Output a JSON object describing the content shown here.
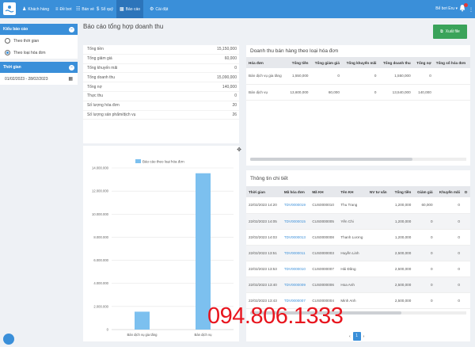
{
  "nav": {
    "items": [
      {
        "label": "Khách hàng",
        "icon": "person-icon"
      },
      {
        "label": "Đề bơi",
        "icon": "pool-icon"
      },
      {
        "label": "Bán vé",
        "icon": "cart-icon"
      },
      {
        "label": "Sổ quỹ",
        "icon": "money-icon"
      },
      {
        "label": "Báo cáo",
        "icon": "chart-icon"
      },
      {
        "label": "Cài đặt",
        "icon": "gear-icon"
      }
    ],
    "user": "Bể bơi Eru",
    "notification_count": "1"
  },
  "sidebar": {
    "report_type": {
      "title": "Kiểu báo cáo",
      "options": [
        "Theo thời gian",
        "Theo loại hóa đơn"
      ],
      "selected": "Theo loại hóa đơn"
    },
    "time": {
      "title": "Thời gian",
      "range": "01/02/2023 - 28/02/2023"
    }
  },
  "page": {
    "title": "Báo cáo tổng hợp doanh thu",
    "export_label": "Xuất file"
  },
  "summary": [
    {
      "label": "Tổng tiền",
      "value": "15,150,000"
    },
    {
      "label": "Tổng giảm giá",
      "value": "60,000"
    },
    {
      "label": "Tổng khuyến mãi",
      "value": "0"
    },
    {
      "label": "Tổng doanh thu",
      "value": "15,090,000"
    },
    {
      "label": "Tổng nợ",
      "value": "140,000"
    },
    {
      "label": "Thực thu",
      "value": "0"
    },
    {
      "label": "Số lượng hóa đơn",
      "value": "20"
    },
    {
      "label": "Số lượng sản phẩm/dịch vụ",
      "value": "26"
    }
  ],
  "chart_data": {
    "type": "bar",
    "categories": [
      "Bán dịch vụ gia tăng",
      "Bán dịch vụ"
    ],
    "series": [
      {
        "name": "Báo cáo theo loại hóa đơn",
        "values": [
          1550000,
          13540000
        ]
      }
    ],
    "ylim": [
      0,
      14000000
    ],
    "yticks": [
      "0",
      "2.000.000",
      "4.000.000",
      "6.000.000",
      "8.000.000",
      "10.000.000",
      "12.000.000",
      "14.000.000"
    ],
    "color": "#7cc0ef"
  },
  "revenue_by_type": {
    "title": "Doanh thu bán hàng theo loại hóa đơn",
    "columns": [
      "Hóa đơn",
      "Tổng tiền",
      "Tổng giảm giá",
      "Tổng khuyến mãi",
      "Tổng doanh thu",
      "Tổng nợ",
      "Tổng số hóa đơn"
    ],
    "rows": [
      [
        "Bán dịch vụ gia tăng",
        "1,550,000",
        "0",
        "0",
        "1,550,000",
        "0",
        ""
      ],
      [
        "Bán dịch vụ",
        "13,600,000",
        "60,000",
        "0",
        "13,540,000",
        "140,000",
        ""
      ]
    ]
  },
  "details": {
    "title": "Thông tin chi tiết",
    "columns": [
      "Thời gian",
      "Mã hóa đơn",
      "Mã KH",
      "Tên KH",
      "NV tư vấn",
      "Tổng tiền",
      "Giảm giá",
      "Khuyến mãi",
      "D"
    ],
    "rows": [
      [
        "22/02/2023 14:20",
        "TDV0000019",
        "CUS0000010",
        "Thu Trang",
        "",
        "1,200,000",
        "60,000",
        "0",
        ""
      ],
      [
        "22/02/2023 14:05",
        "TDV0000015",
        "CUS0000005",
        "Yến Chi",
        "",
        "1,200,000",
        "0",
        "0",
        ""
      ],
      [
        "22/02/2023 14:03",
        "TDV0000013",
        "CUS0000008",
        "Thanh Lương",
        "",
        "1,200,000",
        "0",
        "0",
        ""
      ],
      [
        "22/02/2023 13:51",
        "TDV0000011",
        "CUS0000003",
        "Huyền Linh",
        "",
        "2,500,000",
        "0",
        "0",
        ""
      ],
      [
        "22/02/2023 13:53",
        "TDV0000010",
        "CUS0000007",
        "Hải Đăng",
        "",
        "2,500,000",
        "0",
        "0",
        ""
      ],
      [
        "22/02/2023 13:40",
        "TDV0000009",
        "CUS0000006",
        "Hoa Anh",
        "",
        "2,500,000",
        "0",
        "0",
        ""
      ],
      [
        "22/02/2023 13:43",
        "TDV0000007",
        "CUS0000004",
        "Minh Anh",
        "",
        "2,500,000",
        "0",
        "0",
        ""
      ]
    ],
    "page": "1"
  },
  "watermark": "094.806.1333"
}
